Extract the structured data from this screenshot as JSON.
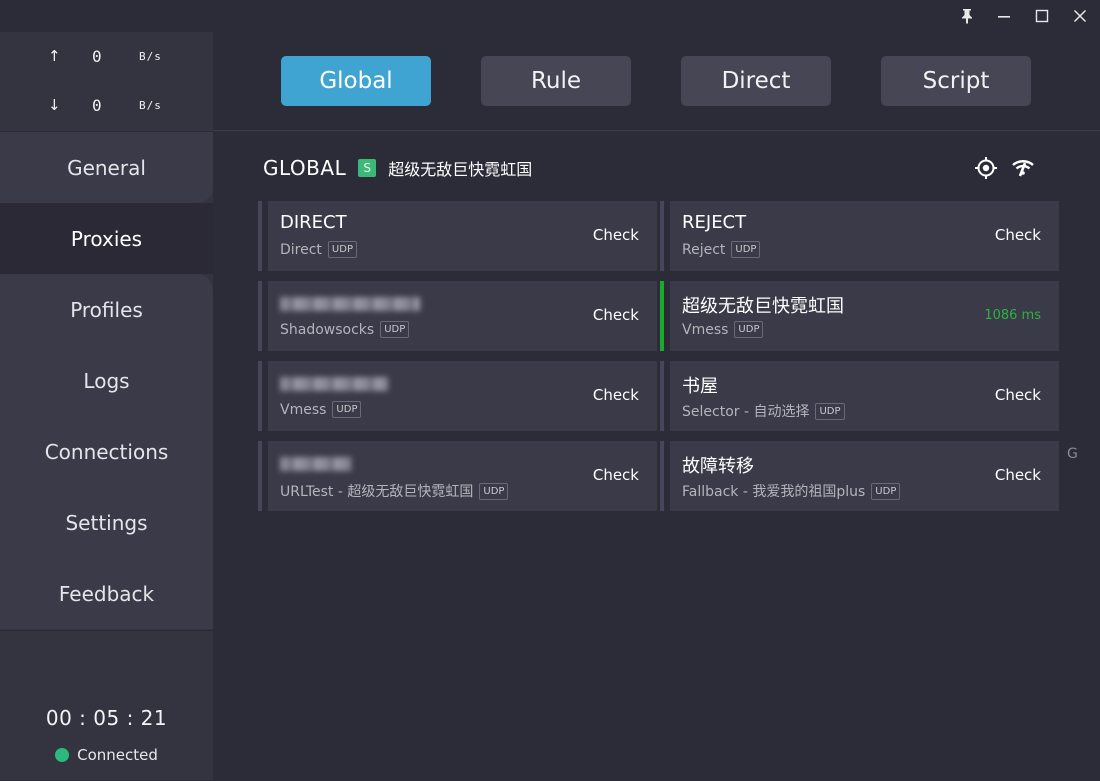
{
  "window": {
    "controls": [
      "pin-icon",
      "minimize-icon",
      "maximize-icon",
      "close-icon"
    ]
  },
  "sidebar": {
    "upload": {
      "arrow": "↑",
      "value": "0",
      "unit": "B/s"
    },
    "download": {
      "arrow": "↓",
      "value": "0",
      "unit": "B/s"
    },
    "nav": [
      {
        "label": "General"
      },
      {
        "label": "Proxies"
      },
      {
        "label": "Profiles"
      },
      {
        "label": "Logs"
      },
      {
        "label": "Connections"
      },
      {
        "label": "Settings"
      },
      {
        "label": "Feedback"
      }
    ],
    "active_nav": "Proxies",
    "timer": "00 : 05 : 21",
    "status": "Connected",
    "status_color": "#2db87d"
  },
  "modes": [
    {
      "label": "Global",
      "active": true
    },
    {
      "label": "Rule",
      "active": false
    },
    {
      "label": "Direct",
      "active": false
    },
    {
      "label": "Script",
      "active": false
    }
  ],
  "group": {
    "title": "GLOBAL",
    "type_badge": "S",
    "selected": "超级无敌巨快霓虹国"
  },
  "proxies": [
    {
      "name": "DIRECT",
      "type": "Direct",
      "udp": "UDP",
      "action": "Check"
    },
    {
      "name": "REJECT",
      "type": "Reject",
      "udp": "UDP",
      "action": "Check"
    },
    {
      "name": "",
      "type": "Shadowsocks",
      "udp": "UDP",
      "action": "Check",
      "redacted": true
    },
    {
      "name": "超级无敌巨快霓虹国",
      "type": "Vmess",
      "udp": "UDP",
      "latency": "1086 ms",
      "selected": true
    },
    {
      "name": "",
      "type": "Vmess",
      "udp": "UDP",
      "action": "Check",
      "redacted": true
    },
    {
      "name": "书屋",
      "type": "Selector - 自动选择",
      "udp": "UDP",
      "action": "Check"
    },
    {
      "name": "",
      "type": "URLTest - 超级无敌巨快霓虹国",
      "udp": "UDP",
      "action": "Check",
      "redacted": true
    },
    {
      "name": "故障转移",
      "type": "Fallback - 我爱我的祖国plus",
      "udp": "UDP",
      "action": "Check"
    }
  ],
  "edge_text": "G",
  "colors": {
    "accent": "#3fa4d2",
    "latency_ok": "#2bb33e",
    "badge": "#3cb878"
  }
}
